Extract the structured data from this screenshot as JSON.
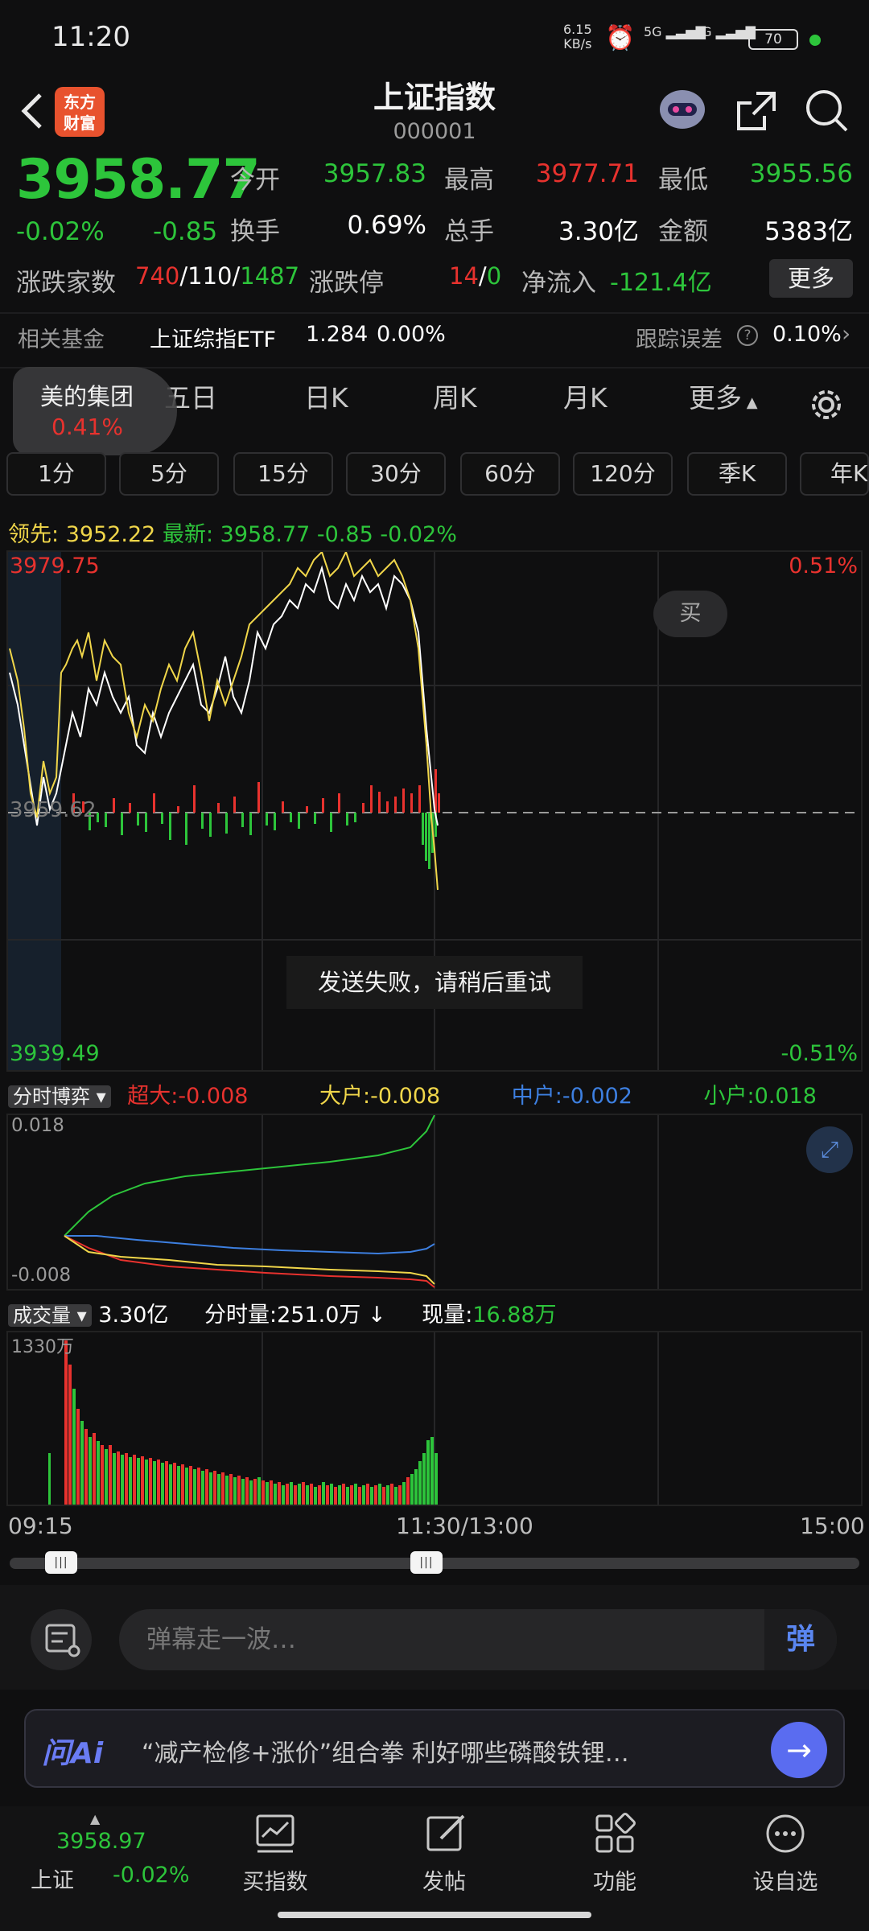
{
  "status_bar": {
    "time": "11:20",
    "net_speed": "6.15",
    "net_unit": "KB/s",
    "signal1": "5G",
    "signal2": "4G",
    "battery": "70"
  },
  "header": {
    "logo_line1": "东方",
    "logo_line2": "财富",
    "title": "上证指数",
    "code": "000001"
  },
  "quote": {
    "price": "3958.77",
    "change_pct": "-0.02%",
    "change": "-0.85",
    "open_label": "今开",
    "open": "3957.83",
    "high_label": "最高",
    "high": "3977.71",
    "low_label": "最低",
    "low": "3955.56",
    "turnover_label": "换手",
    "turnover": "0.69%",
    "volume_label": "总手",
    "volume": "3.30亿",
    "amount_label": "金额",
    "amount": "5383亿",
    "breadth_label": "涨跌家数",
    "breadth_up": "740",
    "breadth_flat": "110",
    "breadth_down": "1487",
    "limit_label": "涨跌停",
    "limit_up": "14",
    "limit_down": "0",
    "inflow_label": "净流入",
    "inflow": "-121.4亿",
    "more": "更多"
  },
  "fund": {
    "label": "相关基金",
    "name": "上证综指ETF",
    "price": "1.284",
    "pct": "0.00%",
    "err_label": "跟踪误差",
    "err": "0.10%"
  },
  "popup": {
    "name": "美的集团",
    "pct": "0.41%"
  },
  "tabs": [
    "五日",
    "日K",
    "周K",
    "月K",
    "更多"
  ],
  "periods": [
    "1分",
    "5分",
    "15分",
    "30分",
    "60分",
    "120分",
    "季K",
    "年K"
  ],
  "lead_line": {
    "lead_label": "领先:",
    "lead": "3952.22",
    "latest_label": "最新:",
    "latest": "3958.77",
    "chg": "-0.85",
    "pct": "-0.02%"
  },
  "main_chart": {
    "y_high": "3979.75",
    "y_low": "3939.49",
    "y_mid": "3959.62",
    "pct_high": "0.51%",
    "pct_low": "-0.51%",
    "buy": "买"
  },
  "toast": "发送失败，请稍后重试",
  "flow": {
    "selector": "分时博弈",
    "super_label": "超大",
    "super": "-0.008",
    "big_label": "大户",
    "big": "-0.008",
    "mid_label": "中户",
    "mid": "-0.002",
    "small_label": "小户",
    "small": "0.018",
    "y_top": "0.018",
    "y_bottom": "-0.008"
  },
  "vol": {
    "selector": "成交量",
    "total": "3.30亿",
    "minute_label": "分时量",
    "minute": "251.0万",
    "now_label": "现量",
    "now": "16.88万",
    "y_top": "1330万"
  },
  "time_axis": {
    "start": "09:15",
    "mid": "11:30/13:00",
    "end": "15:00"
  },
  "danmu": {
    "placeholder": "弹幕走一波…",
    "btn": "弹"
  },
  "ai": {
    "brand": "问Ai",
    "text": "“减产检修+涨价”组合拳 利好哪些磷酸铁锂…"
  },
  "bottom_nav": {
    "index_price": "3958.97",
    "index_name": "上证",
    "index_pct": "-0.02%",
    "items": [
      "买指数",
      "发帖",
      "功能",
      "设自选"
    ]
  },
  "colors": {
    "up": "#e8322e",
    "down": "#2dc53b",
    "lead": "#f0d64a",
    "accent": "#5a6cf0"
  }
}
